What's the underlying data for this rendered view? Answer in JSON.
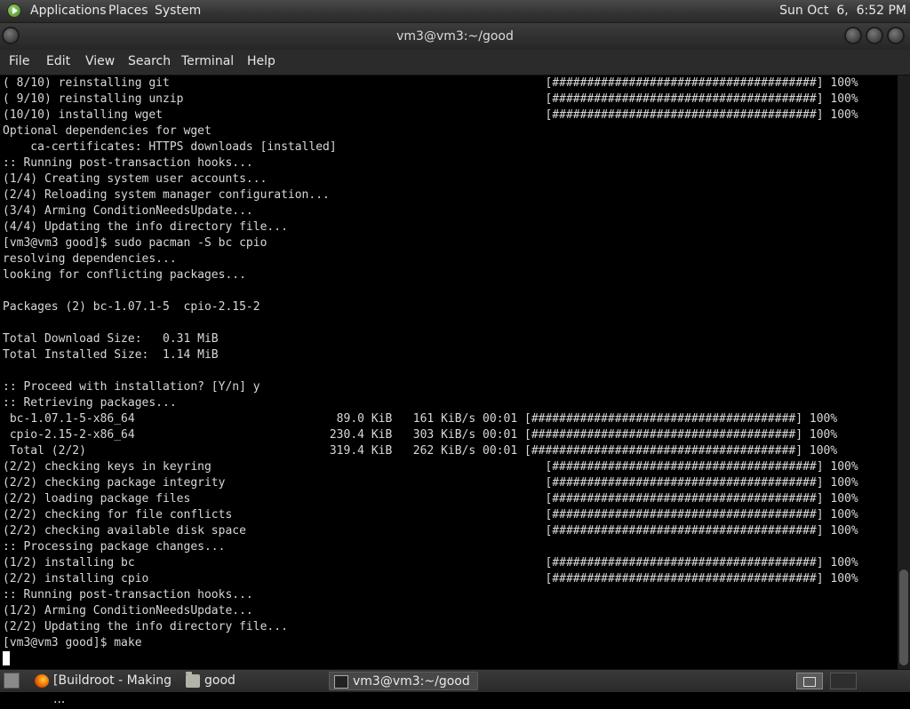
{
  "top_panel": {
    "menus": [
      "Applications",
      "Places",
      "System"
    ],
    "clock": "Sun Oct  6,  6:52 PM"
  },
  "window": {
    "title": "vm3@vm3:~/good",
    "menubar": [
      "File",
      "Edit",
      "View",
      "Search",
      "Terminal",
      "Help"
    ]
  },
  "terminal": {
    "lines": [
      "( 8/10) reinstalling git                                                      [######################################] 100%",
      "( 9/10) reinstalling unzip                                                    [######################################] 100%",
      "(10/10) installing wget                                                       [######################################] 100%",
      "Optional dependencies for wget",
      "    ca-certificates: HTTPS downloads [installed]",
      ":: Running post-transaction hooks...",
      "(1/4) Creating system user accounts...",
      "(2/4) Reloading system manager configuration...",
      "(3/4) Arming ConditionNeedsUpdate...",
      "(4/4) Updating the info directory file...",
      "[vm3@vm3 good]$ sudo pacman -S bc cpio",
      "resolving dependencies...",
      "looking for conflicting packages...",
      "",
      "Packages (2) bc-1.07.1-5  cpio-2.15-2",
      "",
      "Total Download Size:   0.31 MiB",
      "Total Installed Size:  1.14 MiB",
      "",
      ":: Proceed with installation? [Y/n] y",
      ":: Retrieving packages...",
      " bc-1.07.1-5-x86_64                             89.0 KiB   161 KiB/s 00:01 [######################################] 100%",
      " cpio-2.15-2-x86_64                            230.4 KiB   303 KiB/s 00:01 [######################################] 100%",
      " Total (2/2)                                   319.4 KiB   262 KiB/s 00:01 [######################################] 100%",
      "(2/2) checking keys in keyring                                                [######################################] 100%",
      "(2/2) checking package integrity                                              [######################################] 100%",
      "(2/2) loading package files                                                   [######################################] 100%",
      "(2/2) checking for file conflicts                                             [######################################] 100%",
      "(2/2) checking available disk space                                           [######################################] 100%",
      ":: Processing package changes...",
      "(1/2) installing bc                                                           [######################################] 100%",
      "(2/2) installing cpio                                                         [######################################] 100%",
      ":: Running post-transaction hooks...",
      "(1/2) Arming ConditionNeedsUpdate...",
      "(2/2) Updating the info directory file...",
      "[vm3@vm3 good]$ make"
    ]
  },
  "taskbar": {
    "tasks": [
      {
        "label": "[Buildroot - Making ...",
        "icon": "firefox-icon"
      },
      {
        "label": "good",
        "icon": "folder-icon"
      },
      {
        "label": "vm3@vm3:~/good",
        "icon": "terminal-icon"
      }
    ]
  }
}
